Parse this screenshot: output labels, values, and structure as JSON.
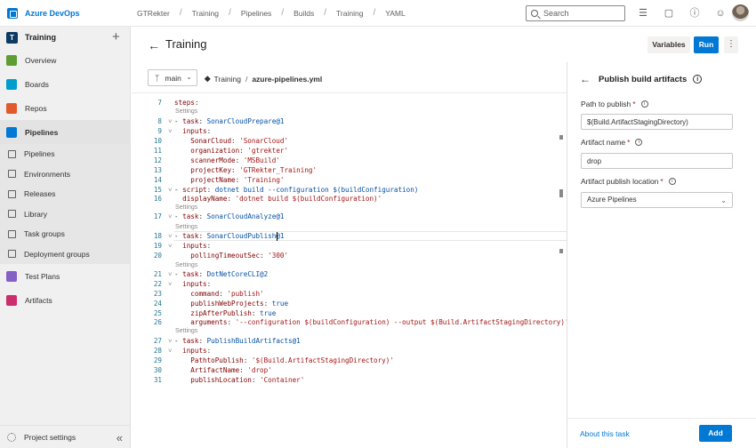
{
  "topbar": {
    "app_name": "Azure DevOps",
    "breadcrumbs": [
      "GTRekter",
      "Training",
      "Pipelines",
      "Builds",
      "Training",
      "YAML"
    ],
    "search_placeholder": "Search"
  },
  "sidebar": {
    "project_initial": "T",
    "project_name": "Training",
    "items": [
      {
        "label": "Overview",
        "color": "#5c9e31"
      },
      {
        "label": "Boards",
        "color": "#009ccc"
      },
      {
        "label": "Repos",
        "color": "#e05a2b"
      },
      {
        "label": "Pipelines",
        "color": "#0078d4"
      }
    ],
    "pipelines_sub": [
      "Pipelines",
      "Environments",
      "Releases",
      "Library",
      "Task groups",
      "Deployment groups"
    ],
    "items_after": [
      {
        "label": "Test Plans",
        "color": "#8661c5"
      },
      {
        "label": "Artifacts",
        "color": "#cb2e6d"
      }
    ],
    "settings_label": "Project settings"
  },
  "header": {
    "title": "Training",
    "variables_label": "Variables",
    "run_label": "Run"
  },
  "editor": {
    "branch": "main",
    "repo": "Training",
    "file": "azure-pipelines.yml",
    "lines": [
      {
        "n": "7",
        "t": "steps:"
      },
      {
        "n": "8",
        "t": "- task: SonarCloudPrepare@1"
      },
      {
        "n": "9",
        "t": "  inputs:"
      },
      {
        "n": "10",
        "t": "    SonarCloud: 'SonarCloud'"
      },
      {
        "n": "11",
        "t": "    organization: 'gtrekter'"
      },
      {
        "n": "12",
        "t": "    scannerMode: 'MSBuild'"
      },
      {
        "n": "13",
        "t": "    projectKey: 'GTRekter_Training'"
      },
      {
        "n": "14",
        "t": "    projectName: 'Training'"
      },
      {
        "n": "15",
        "t": "- script: dotnet build --configuration $(buildConfiguration)"
      },
      {
        "n": "16",
        "t": "  displayName: 'dotnet build $(buildConfiguration)'"
      },
      {
        "n": "17",
        "t": "- task: SonarCloudAnalyze@1"
      },
      {
        "n": "18",
        "t": "- task: SonarCloudPublish@1"
      },
      {
        "n": "19",
        "t": "  inputs:"
      },
      {
        "n": "20",
        "t": "    pollingTimeoutSec: '300'"
      },
      {
        "n": "21",
        "t": "- task: DotNetCoreCLI@2"
      },
      {
        "n": "22",
        "t": "  inputs:"
      },
      {
        "n": "23",
        "t": "    command: 'publish'"
      },
      {
        "n": "24",
        "t": "    publishWebProjects: true"
      },
      {
        "n": "25",
        "t": "    zipAfterPublish: true"
      },
      {
        "n": "26",
        "t": "    arguments: '--configuration $(buildConfiguration) --output $(Build.ArtifactStagingDirectory)'"
      },
      {
        "n": "27",
        "t": "- task: PublishBuildArtifacts@1"
      },
      {
        "n": "28",
        "t": "  inputs:"
      },
      {
        "n": "29",
        "t": "    PathtoPublish: '$(Build.ArtifactStagingDirectory)'"
      },
      {
        "n": "30",
        "t": "    ArtifactName: 'drop'"
      },
      {
        "n": "31",
        "t": "    publishLocation: 'Container'"
      }
    ],
    "settings_lens": "Settings"
  },
  "panel": {
    "title": "Publish build artifacts",
    "path_label": "Path to publish",
    "path_value": "$(Build.ArtifactStagingDirectory)",
    "artifact_label": "Artifact name",
    "artifact_value": "drop",
    "location_label": "Artifact publish location",
    "location_value": "Azure Pipelines",
    "about_link": "About this task",
    "add_label": "Add"
  }
}
